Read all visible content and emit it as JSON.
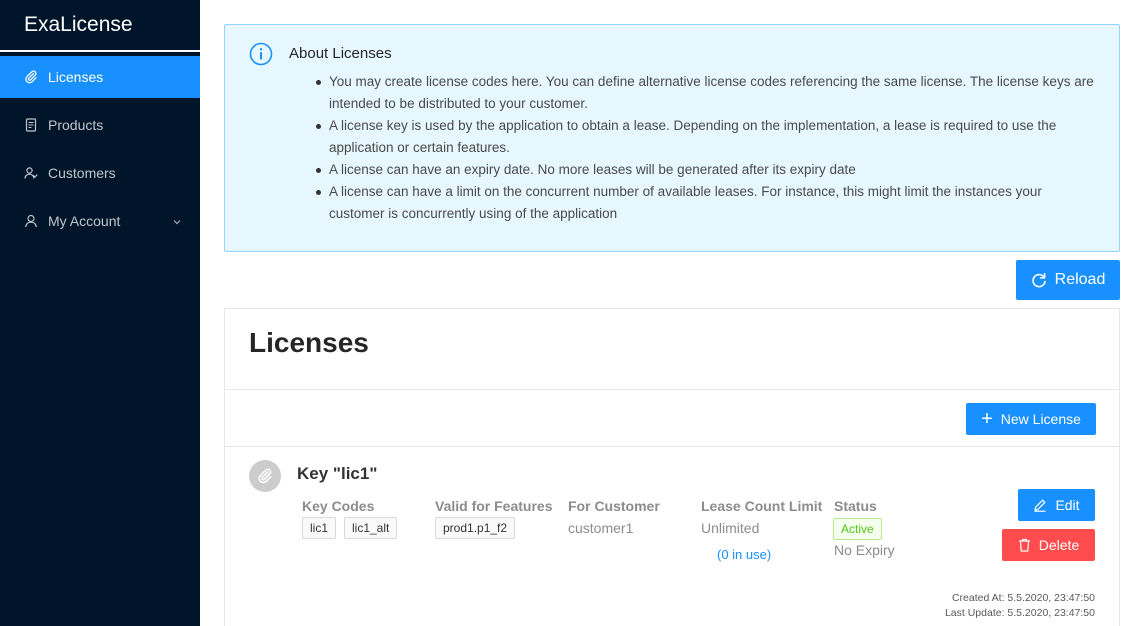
{
  "app": {
    "title": "ExaLicense"
  },
  "sidebar": {
    "items": [
      {
        "label": "Licenses",
        "icon": "paperclip-icon",
        "active": true
      },
      {
        "label": "Products",
        "icon": "document-icon"
      },
      {
        "label": "Customers",
        "icon": "users-icon"
      },
      {
        "label": "My Account",
        "icon": "user-icon"
      }
    ]
  },
  "info": {
    "title": "About Licenses",
    "bullets": [
      "You may create license codes here. You can define alternative license codes referencing the same license. The license keys are intended to be distributed to your customer.",
      "A license key is used by the application to obtain a lease. Depending on the implementation, a lease is required to use the application or certain features.",
      "A license can have an expiry date. No more leases will be generated after its expiry date",
      "A license can have a limit on the concurrent number of available leases. For instance, this might limit the instances your customer is concurrently using of the application"
    ]
  },
  "toolbar": {
    "reload_label": "Reload"
  },
  "licenses": {
    "title": "Licenses",
    "new_label": "New License",
    "columns": {
      "key_codes": "Key Codes",
      "features": "Valid for Features",
      "customer": "For Customer",
      "lease_limit": "Lease Count Limit",
      "status": "Status"
    },
    "items": [
      {
        "title": "Key \"lic1\"",
        "key_codes": [
          "lic1",
          "lic1_alt"
        ],
        "features": [
          "prod1.p1_f2"
        ],
        "customer": "customer1",
        "lease_limit": "Unlimited",
        "in_use": "(0 in use)",
        "status": "Active",
        "expiry": "No Expiry",
        "edit_label": "Edit",
        "delete_label": "Delete",
        "created": "Created At: 5.5.2020, 23:47:50",
        "updated": "Last Update: 5.5.2020, 23:47:50"
      }
    ]
  },
  "colors": {
    "sidebar_bg": "#001529",
    "primary": "#1890ff",
    "danger": "#ff4d4f",
    "success": "#52c41a",
    "info_bg": "#e6f7ff"
  }
}
